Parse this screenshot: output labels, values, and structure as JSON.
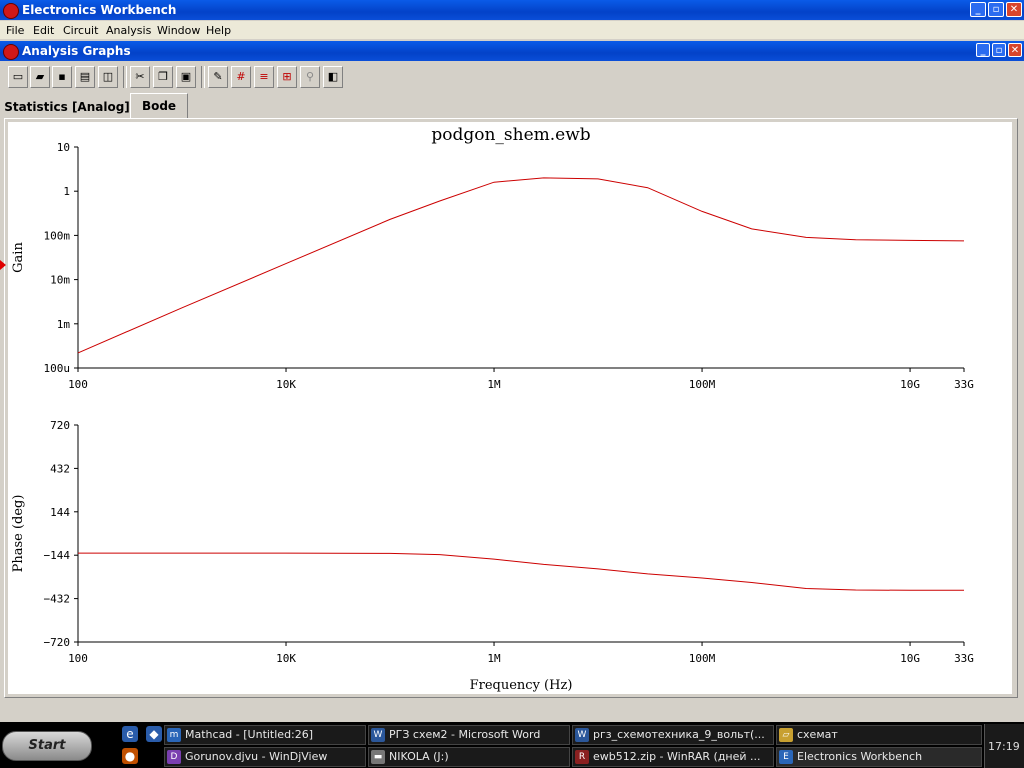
{
  "window": {
    "title": "Electronics Workbench",
    "buttons": {
      "minimize": "_",
      "maximize": "▫",
      "close": "✕"
    }
  },
  "menu": [
    "File",
    "Edit",
    "Circuit",
    "Analysis",
    "Window",
    "Help"
  ],
  "child_window": {
    "title": "Analysis Graphs",
    "buttons": {
      "minimize": "_",
      "maximize": "▫",
      "close": "✕"
    }
  },
  "toolbar": {
    "buttons": [
      {
        "name": "new-icon",
        "glyph": "▭"
      },
      {
        "name": "open-icon",
        "glyph": "▰"
      },
      {
        "name": "save-icon",
        "glyph": "▪"
      },
      {
        "name": "print-icon",
        "glyph": "▤"
      },
      {
        "name": "print-preview-icon",
        "glyph": "◫"
      },
      {
        "name": "cut-icon",
        "glyph": "✂"
      },
      {
        "name": "copy-icon",
        "glyph": "❐"
      },
      {
        "name": "paste-icon",
        "glyph": "▣"
      },
      {
        "name": "properties-icon",
        "glyph": "✎"
      },
      {
        "name": "grid-icon",
        "glyph": "#"
      },
      {
        "name": "legend-icon",
        "glyph": "≡"
      },
      {
        "name": "cursors-icon",
        "glyph": "⊞"
      },
      {
        "name": "zoom-icon",
        "glyph": "⚲"
      },
      {
        "name": "reverse-colors-icon",
        "glyph": "◧"
      }
    ]
  },
  "tabs": [
    {
      "label": "Statistics [Analog]",
      "active": false
    },
    {
      "label": "Bode",
      "active": true
    }
  ],
  "colors": {
    "trace": "#cc0000",
    "marker": "#e00000"
  },
  "chart_data": [
    {
      "type": "line",
      "title": "podgon_shem.ewb",
      "ylabel": "Gain",
      "xlabel": "",
      "xscale": "log",
      "yscale": "log",
      "xlim": [
        100,
        33000000000
      ],
      "ylim": [
        0.0001,
        10
      ],
      "x_ticks": [
        {
          "value": 100,
          "label": "100"
        },
        {
          "value": 10000,
          "label": "10K"
        },
        {
          "value": 1000000,
          "label": "1M"
        },
        {
          "value": 100000000,
          "label": "100M"
        },
        {
          "value": 10000000000,
          "label": "10G"
        },
        {
          "value": 33000000000,
          "label": "33G"
        }
      ],
      "y_ticks": [
        {
          "value": 10,
          "label": "10"
        },
        {
          "value": 1,
          "label": "1"
        },
        {
          "value": 0.1,
          "label": "100m"
        },
        {
          "value": 0.01,
          "label": "10m"
        },
        {
          "value": 0.001,
          "label": "1m"
        },
        {
          "value": 0.0001,
          "label": "100u"
        }
      ],
      "series": [
        {
          "x": [
            100,
            1000,
            10000,
            100000,
            300000,
            1000000,
            3000000,
            10000000,
            30000000,
            100000000,
            300000000,
            1000000000,
            3000000000,
            10000000000,
            33000000000
          ],
          "y": [
            0.00022,
            0.0023,
            0.023,
            0.23,
            0.6,
            1.6,
            2.0,
            1.9,
            1.2,
            0.35,
            0.14,
            0.09,
            0.08,
            0.077,
            0.075
          ]
        }
      ]
    },
    {
      "type": "line",
      "title": "",
      "ylabel": "Phase (deg)",
      "xlabel": "Frequency (Hz)",
      "xscale": "log",
      "xlim": [
        100,
        33000000000
      ],
      "ylim": [
        -720,
        720
      ],
      "x_ticks": [
        {
          "value": 100,
          "label": "100"
        },
        {
          "value": 10000,
          "label": "10K"
        },
        {
          "value": 1000000,
          "label": "1M"
        },
        {
          "value": 100000000,
          "label": "100M"
        },
        {
          "value": 10000000000,
          "label": "10G"
        },
        {
          "value": 33000000000,
          "label": "33G"
        }
      ],
      "y_ticks": [
        {
          "value": 720,
          "label": "720"
        },
        {
          "value": 432,
          "label": "432"
        },
        {
          "value": 144,
          "label": "144"
        },
        {
          "value": -144,
          "label": "−144"
        },
        {
          "value": -432,
          "label": "−432"
        },
        {
          "value": -720,
          "label": "−720"
        }
      ],
      "series": [
        {
          "x": [
            100,
            1000,
            10000,
            100000,
            300000,
            1000000,
            3000000,
            10000000,
            30000000,
            100000000,
            300000000,
            1000000000,
            3000000000,
            10000000000,
            33000000000
          ],
          "y": [
            -130,
            -130,
            -130,
            -132,
            -140,
            -170,
            -205,
            -235,
            -268,
            -295,
            -325,
            -365,
            -375,
            -377,
            -377
          ]
        }
      ]
    }
  ],
  "taskbar": {
    "start_label": "Start",
    "quick_launch": [
      {
        "name": "ie-icon",
        "glyph": "e"
      },
      {
        "name": "desktop-icon",
        "glyph": "◆"
      },
      {
        "name": "media-icon",
        "glyph": "●"
      }
    ],
    "tasks": [
      {
        "label": "Mathcad - [Untitled:26]",
        "icon": "m",
        "color": "#2a66b8"
      },
      {
        "label": "РГЗ схем2 - Microsoft Word",
        "icon": "W",
        "color": "#2b579a"
      },
      {
        "label": "ргз_схемотехника_9_вольт(...",
        "icon": "W",
        "color": "#2b579a"
      },
      {
        "label": "схемат",
        "icon": "▱",
        "color": "#c8a030"
      },
      {
        "label": "Gorunov.djvu - WinDjView",
        "icon": "D",
        "color": "#7a3fb0"
      },
      {
        "label": "NIKOLA (J:)",
        "icon": "▬",
        "color": "#777"
      },
      {
        "label": "ewb512.zip - WinRAR (дней ...",
        "icon": "R",
        "color": "#8a2020"
      },
      {
        "label": "Electronics Workbench",
        "icon": "E",
        "color": "#2a66b8"
      }
    ],
    "clock": "17:19"
  }
}
